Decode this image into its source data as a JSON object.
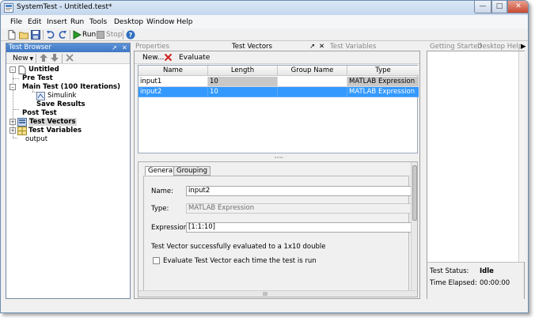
{
  "window": {
    "title": "SystemTest - Untitled.test*"
  },
  "menu": [
    "File",
    "Edit",
    "Insert",
    "Run",
    "Tools",
    "Desktop",
    "Window",
    "Help"
  ],
  "toolbar": {
    "run_label": "Run",
    "stop_label": "Stop"
  },
  "test_browser": {
    "title": "Test Browser",
    "new_label": "New",
    "tree": [
      {
        "label": "Untitled",
        "bold": true
      },
      {
        "label": "Pre Test",
        "bold": true
      },
      {
        "label": "Main Test (100 Iterations)",
        "bold": true
      },
      {
        "label": "Simulink",
        "bold": false
      },
      {
        "label": "Save Results",
        "bold": true
      },
      {
        "label": "Post Test",
        "bold": true
      },
      {
        "label": "Test Vectors",
        "bold": true
      },
      {
        "label": "Test Variables",
        "bold": true
      },
      {
        "label": "output",
        "bold": false
      }
    ]
  },
  "tabs": {
    "properties": "Properties",
    "test_vectors": "Test Vectors",
    "test_variables": "Test Variables"
  },
  "vector_toolbar": {
    "new_label": "New...",
    "evaluate_label": "Evaluate"
  },
  "vector_table": {
    "columns": [
      "Name",
      "Length",
      "Group Name",
      "Type"
    ],
    "rows": [
      {
        "name": "input1",
        "length": "10",
        "group": "",
        "type": "MATLAB Expression"
      },
      {
        "name": "input2",
        "length": "10",
        "group": "",
        "type": "MATLAB Expression"
      }
    ],
    "selected_row": 1
  },
  "detail": {
    "tabs": [
      "General",
      "Grouping"
    ],
    "name_label": "Name:",
    "name_value": "input2",
    "type_label": "Type:",
    "type_value": "MATLAB Expression",
    "expression_label": "Expression:",
    "expression_value": "[1:1:10]",
    "message": "Test Vector successfully evaluated to a 1x10 double",
    "checkbox_label": "Evaluate Test Vector each time the test is run"
  },
  "right_tabs": {
    "getting_started": "Getting Started",
    "desktop_help": "Desktop Help"
  },
  "status": {
    "test_status_label": "Test Status:",
    "test_status_value": "Idle",
    "time_elapsed_label": "Time Elapsed:",
    "time_elapsed_value": "00:00:00"
  },
  "colors": {
    "selection": "#3399ff",
    "panel_header": "#4a84cc"
  }
}
